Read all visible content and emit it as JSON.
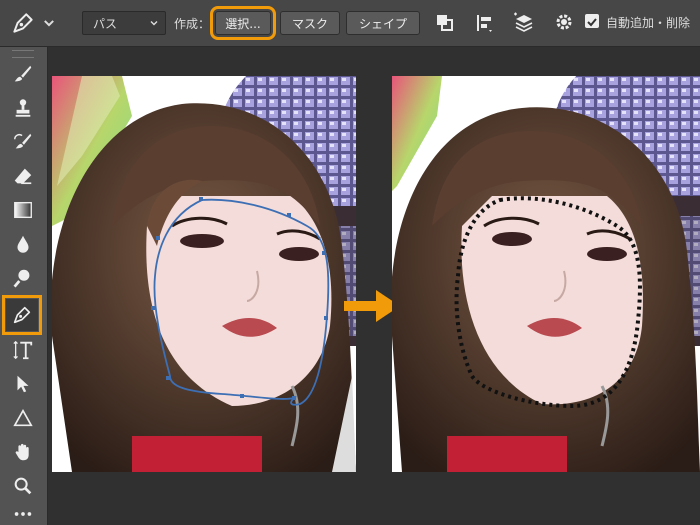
{
  "options_bar": {
    "mode_select": "パス",
    "make_label": "作成：",
    "selection_button": "選択...",
    "mask_button": "マスク",
    "shape_button": "シェイプ",
    "auto_add_delete_label": "自動追加・削除",
    "auto_add_delete_checked": true
  },
  "colors": {
    "accent_highlight": "#f29b0a",
    "path_line": "#3d6fb5"
  },
  "icons": [
    "pen-tool-icon",
    "chevron-down-icon",
    "path-operations-icon",
    "path-alignment-icon",
    "path-arrangement-icon",
    "gear-icon",
    "checkbox-icon",
    "brush-icon",
    "stamp-icon",
    "history-brush-icon",
    "eraser-icon",
    "gradient-icon",
    "blur-icon",
    "dodge-icon",
    "pen-icon",
    "type-icon",
    "path-selection-icon",
    "shape-icon",
    "hand-icon",
    "zoom-icon",
    "more-icon",
    "arrow-right-icon"
  ]
}
